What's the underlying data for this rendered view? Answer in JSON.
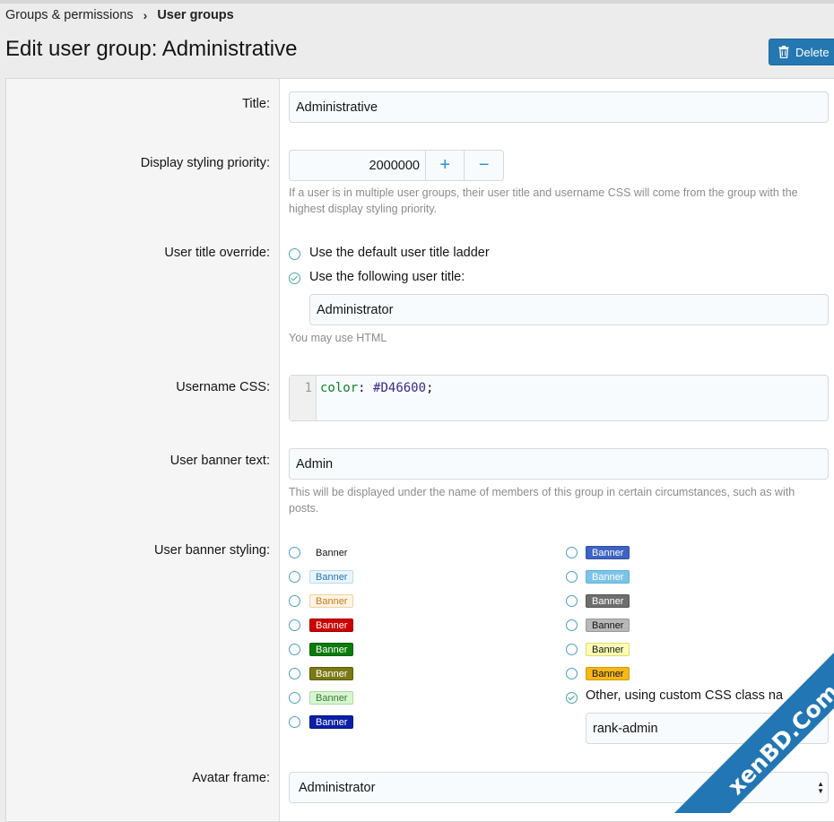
{
  "breadcrumb": {
    "parent": "Groups & permissions",
    "current": "User groups"
  },
  "page": {
    "title": "Edit user group: Administrative",
    "delete_label": "Delete"
  },
  "fields": {
    "title": {
      "label": "Title:",
      "value": "Administrative"
    },
    "priority": {
      "label": "Display styling priority:",
      "value": "2000000",
      "plus": "+",
      "minus": "−",
      "hint": "If a user is in multiple user groups, their user title and username CSS will come from the group with the highest display styling priority."
    },
    "user_title": {
      "label": "User title override:",
      "option_default": "Use the default user title ladder",
      "option_custom": "Use the following user title:",
      "value": "Administrator",
      "hint": "You may use HTML"
    },
    "username_css": {
      "label": "Username CSS:",
      "line_no": "1",
      "prop": "color",
      "colon": ":",
      "value": "#D46600",
      "semi": ";"
    },
    "banner_text": {
      "label": "User banner text:",
      "value": "Admin",
      "hint": "This will be displayed under the name of members of this group in certain circumstances, such as with posts."
    },
    "banner_styling": {
      "label": "User banner styling:",
      "other_label": "Other, using custom CSS class name:",
      "other_value": "rank-admin",
      "banners": [
        {
          "text": "Banner",
          "bg": "transparent",
          "fg": "#141414",
          "border": "transparent"
        },
        {
          "text": "Banner",
          "bg": "#eaf5fb",
          "fg": "#2577b1",
          "border": "#b9dcef"
        },
        {
          "text": "Banner",
          "bg": "#fdf4e3",
          "fg": "#c57b16",
          "border": "#f2d39d"
        },
        {
          "text": "Banner",
          "bg": "#cc0000",
          "fg": "#ffffff",
          "border": "#a10000"
        },
        {
          "text": "Banner",
          "bg": "#0a7b0a",
          "fg": "#ffffff",
          "border": "#075f07"
        },
        {
          "text": "Banner",
          "bg": "#7a7a14",
          "fg": "#ffffff",
          "border": "#5c5c0d"
        },
        {
          "text": "Banner",
          "bg": "#d8f5d2",
          "fg": "#3a7a2f",
          "border": "#a9dda0"
        },
        {
          "text": "Banner",
          "bg": "#0b1fa8",
          "fg": "#ffffff",
          "border": "#071580"
        },
        {
          "text": "Banner",
          "bg": "#3e63c4",
          "fg": "#ffffff",
          "border": "#2f4fa2"
        },
        {
          "text": "Banner",
          "bg": "#7cc4e6",
          "fg": "#ffffff",
          "border": "#5fb1d8"
        },
        {
          "text": "Banner",
          "bg": "#6e6e6e",
          "fg": "#ffffff",
          "border": "#555555"
        },
        {
          "text": "Banner",
          "bg": "#b8b8b8",
          "fg": "#141414",
          "border": "#999999"
        },
        {
          "text": "Banner",
          "bg": "#fdfcb5",
          "fg": "#141414",
          "border": "#e0dd6c"
        },
        {
          "text": "Banner",
          "bg": "#f4b81a",
          "fg": "#141414",
          "border": "#d59a00"
        }
      ]
    },
    "avatar_frame": {
      "label": "Avatar frame:",
      "value": "Administrator"
    }
  },
  "watermark": {
    "text": "xenBD.Com",
    "color": "#2276b3"
  },
  "icons": {
    "delete": "trash-icon",
    "select": "select-arrows-icon"
  }
}
